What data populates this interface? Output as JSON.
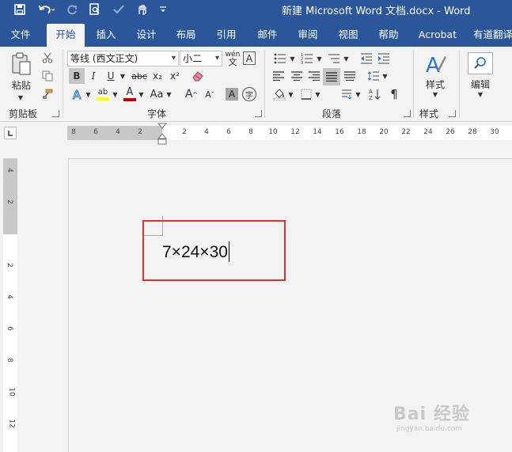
{
  "titlebar": {
    "title": "新建 Microsoft Word 文档.docx  -  Word",
    "save_icon": "save-icon",
    "undo_icon": "undo-icon",
    "redo_icon": "redo-icon",
    "print_preview_icon": "print-preview-icon",
    "touch_icon": "touch-mode-icon",
    "customize_icon": "customize-qat-icon"
  },
  "tabs": [
    {
      "label": "文件"
    },
    {
      "label": "开始"
    },
    {
      "label": "插入"
    },
    {
      "label": "设计"
    },
    {
      "label": "布局"
    },
    {
      "label": "引用"
    },
    {
      "label": "邮件"
    },
    {
      "label": "审阅"
    },
    {
      "label": "视图"
    },
    {
      "label": "帮助"
    },
    {
      "label": "Acrobat"
    },
    {
      "label": "有道翻译"
    }
  ],
  "ribbon": {
    "clipboard": {
      "paste_label": "粘贴",
      "group_label": "剪贴板"
    },
    "font": {
      "font_name": "等线 (西文正文)",
      "font_size": "小二",
      "bold": "B",
      "italic": "I",
      "underline": "U",
      "strikethrough": "abc",
      "subscript": "x₂",
      "superscript": "x²",
      "grow_font": "A",
      "shrink_font": "A",
      "change_case": "Aa",
      "group_label": "字体",
      "font_color": "#c00000",
      "highlight_color": "#ffff00"
    },
    "paragraph": {
      "group_label": "段落"
    },
    "styles": {
      "styles_label": "样式",
      "group_label": "样式"
    },
    "editing": {
      "editing_label": "编辑"
    }
  },
  "ruler": {
    "h_ticks": [
      "8",
      "6",
      "4",
      "2",
      "2",
      "4",
      "6",
      "8",
      "10",
      "12",
      "14",
      "16",
      "18",
      "20",
      "22",
      "24",
      "26",
      "28",
      "30"
    ],
    "v_ticks": [
      "4",
      "2",
      "2",
      "4",
      "6",
      "8",
      "10",
      "12"
    ]
  },
  "document": {
    "text": "7×24×30"
  },
  "watermark": {
    "main": "Bai 经验",
    "sub": "jingyan.baidu.com"
  }
}
